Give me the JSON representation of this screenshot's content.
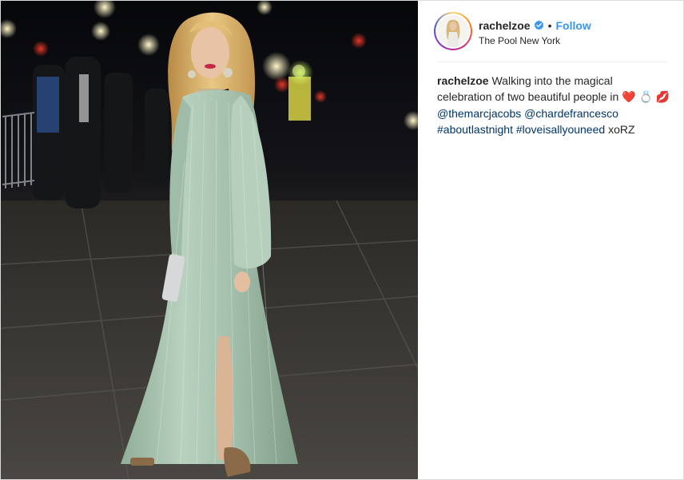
{
  "post": {
    "username": "rachelzoe",
    "verified": true,
    "separator": "•",
    "follow_label": "Follow",
    "location": "The Pool New York",
    "caption": {
      "username": "rachelzoe",
      "text_1": "Walking into the magical celebration of two beautiful people in",
      "emoji_heart": "❤️",
      "emoji_ring": "💍",
      "emoji_lips": "💋",
      "mention_1": "@themarcjacobs",
      "mention_2": "@chardefrancesco",
      "hashtag_1": "#aboutlastnight",
      "hashtag_2": "#loveisallyouneed",
      "signoff": "xoRZ"
    }
  },
  "colors": {
    "link_blue": "#003569",
    "follow_blue": "#3897f0",
    "verified_blue": "#3897f0",
    "dress_mint": "#a9c6b2",
    "hair_blonde": "#d8b06a",
    "platform_gold": "#8a6a48"
  },
  "icons": {
    "verified": "verified-badge-icon"
  }
}
